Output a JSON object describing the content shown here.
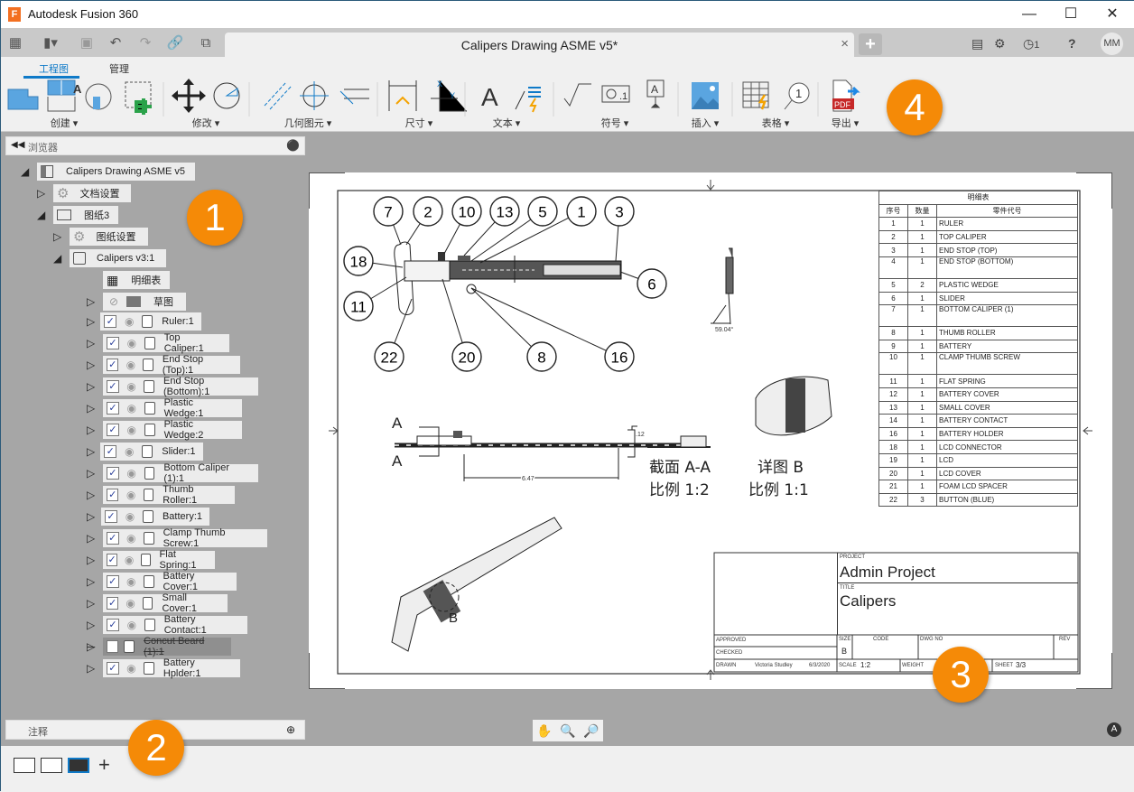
{
  "window": {
    "title": "Autodesk Fusion 360",
    "app_icon": "F",
    "controls": [
      "minimize",
      "maximize",
      "close"
    ]
  },
  "tabbar": {
    "quick_access": [
      "grid-icon",
      "file-icon",
      "save-icon",
      "undo-icon",
      "redo-icon",
      "link-icon",
      "copy-icon"
    ],
    "doc_title": "Calipers Drawing ASME v5*",
    "close_label": "×",
    "new_tab_label": "+",
    "job_count": "1",
    "avatar": "MM"
  },
  "ribbon": {
    "tabs": [
      {
        "label": "工程图",
        "active": true
      },
      {
        "label": "管理",
        "active": false
      }
    ],
    "groups": [
      {
        "label": "创建 ▾"
      },
      {
        "label": "修改 ▾"
      },
      {
        "label": "几何图元 ▾"
      },
      {
        "label": "尺寸 ▾"
      },
      {
        "label": "文本 ▾"
      },
      {
        "label": "符号 ▾"
      },
      {
        "label": "插入 ▾"
      },
      {
        "label": "表格 ▾"
      },
      {
        "label": "导出 ▾"
      }
    ]
  },
  "browser": {
    "title": "浏览器",
    "root": "Calipers Drawing ASME v5",
    "doc_settings": "文档设置",
    "sheet": "图纸3",
    "sheet_settings": "图纸设置",
    "component": "Calipers v3:1",
    "parts_list": "明细表",
    "sketches": "草图",
    "items": [
      {
        "label": "Ruler:1",
        "visible": true
      },
      {
        "label": "Top Caliper:1",
        "visible": true
      },
      {
        "label": "End Stop (Top):1",
        "visible": true
      },
      {
        "label": "End Stop (Bottom):1",
        "visible": true
      },
      {
        "label": "Plastic Wedge:1",
        "visible": true
      },
      {
        "label": "Plastic Wedge:2",
        "visible": true
      },
      {
        "label": "Slider:1",
        "visible": true
      },
      {
        "label": "Bottom Caliper (1):1",
        "visible": true
      },
      {
        "label": "Thumb Roller:1",
        "visible": true
      },
      {
        "label": "Battery:1",
        "visible": true
      },
      {
        "label": "Clamp Thumb Screw:1",
        "visible": true
      },
      {
        "label": "Flat Spring:1",
        "visible": true
      },
      {
        "label": "Battery Cover:1",
        "visible": true
      },
      {
        "label": "Small Cover:1",
        "visible": true
      },
      {
        "label": "Battery Contact:1",
        "visible": true
      },
      {
        "label": "Concut Beard (1):1",
        "visible": false
      },
      {
        "label": "Battery Hplder:1",
        "visible": true
      }
    ]
  },
  "notes": {
    "title": "注释"
  },
  "drawing": {
    "balloons": [
      "7",
      "2",
      "10",
      "13",
      "5",
      "1",
      "3",
      "18",
      "6",
      "11",
      "22",
      "20",
      "8",
      "16"
    ],
    "angle_dim": "59.04°",
    "section_label": "A",
    "dim_length": "6.47",
    "dim_small": ".12",
    "section_caption": "截面 A-A",
    "section_scale": "比例 1:2",
    "detail_caption": "详图 B",
    "detail_scale": "比例 1:1",
    "detail_label": "B",
    "parts_list": {
      "title": "明细表",
      "headers": [
        "序号",
        "数量",
        "零件代号"
      ],
      "rows": [
        [
          "1",
          "1",
          "RULER"
        ],
        [
          "2",
          "1",
          "TOP CALIPER"
        ],
        [
          "3",
          "1",
          "END STOP (TOP)"
        ],
        [
          "4",
          "1",
          "END STOP (BOTTOM)"
        ],
        [
          "5",
          "2",
          "PLASTIC WEDGE"
        ],
        [
          "6",
          "1",
          "SLIDER"
        ],
        [
          "7",
          "1",
          "BOTTOM CALIPER (1)"
        ],
        [
          "8",
          "1",
          "THUMB ROLLER"
        ],
        [
          "9",
          "1",
          "BATTERY"
        ],
        [
          "10",
          "1",
          "CLAMP THUMB SCREW"
        ],
        [
          "11",
          "1",
          "FLAT SPRING"
        ],
        [
          "12",
          "1",
          "BATTERY COVER"
        ],
        [
          "13",
          "1",
          "SMALL COVER"
        ],
        [
          "14",
          "1",
          "BATTERY CONTACT"
        ],
        [
          "16",
          "1",
          "BATTERY HOLDER"
        ],
        [
          "18",
          "1",
          "LCD CONNECTOR"
        ],
        [
          "19",
          "1",
          "LCD"
        ],
        [
          "20",
          "1",
          "LCD COVER"
        ],
        [
          "21",
          "1",
          "FOAM LCD SPACER"
        ],
        [
          "22",
          "3",
          "BUTTON (BLUE)"
        ]
      ]
    },
    "title_block": {
      "project_label": "PROJECT",
      "project": "Admin Project",
      "title_label": "TITLE",
      "title": "Calipers",
      "approved": "APPROVED",
      "checked": "CHECKED",
      "drawn": "DRAWN",
      "drawn_by": "Victoria Studley",
      "drawn_date": "6/3/2020",
      "size_label": "SIZE",
      "size": "B",
      "code_label": "CODE",
      "dwg_label": "DWG NO",
      "rev_label": "REV",
      "scale_label": "SCALE",
      "scale": "1:2",
      "weight_label": "WEIGHT",
      "sheet_label": "SHEET",
      "sheet": "3/3"
    }
  },
  "navbar": [
    "pan-icon",
    "zoom-window-icon",
    "zoom-fit-icon"
  ],
  "sheets": {
    "count": 3,
    "active": 3,
    "add_label": "+"
  },
  "callouts": [
    "1",
    "2",
    "3",
    "4"
  ],
  "colors": {
    "accent": "#0f7ac8",
    "callout": "#f58a07",
    "canvas": "#a6a6a6"
  }
}
